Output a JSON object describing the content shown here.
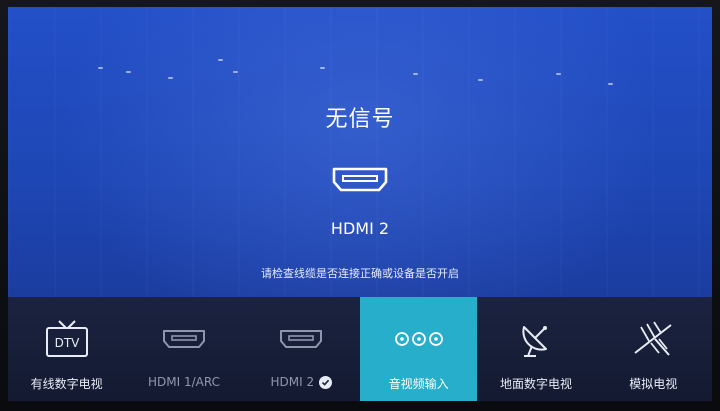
{
  "status": {
    "title": "无信号",
    "source_name": "HDMI 2",
    "hint": "请检查线缆是否连接正确或设备是否开启"
  },
  "sources": [
    {
      "label": "有线数字电视",
      "icon": "dtv-tv-icon",
      "icon_text": "DTV",
      "state": "normal"
    },
    {
      "label": "HDMI 1/ARC",
      "icon": "hdmi-port-icon",
      "state": "dim"
    },
    {
      "label": "HDMI 2",
      "icon": "hdmi-port-icon",
      "state": "dim",
      "checked": true
    },
    {
      "label": "音视频输入",
      "icon": "av-jacks-icon",
      "state": "selected"
    },
    {
      "label": "地面数字电视",
      "icon": "satellite-dish-icon",
      "state": "normal"
    },
    {
      "label": "模拟电视",
      "icon": "antenna-icon",
      "state": "normal"
    }
  ],
  "colors": {
    "screen_blue": "#2350c8",
    "bar_bg": "#1b2340",
    "selected_tile": "#27aeca"
  }
}
